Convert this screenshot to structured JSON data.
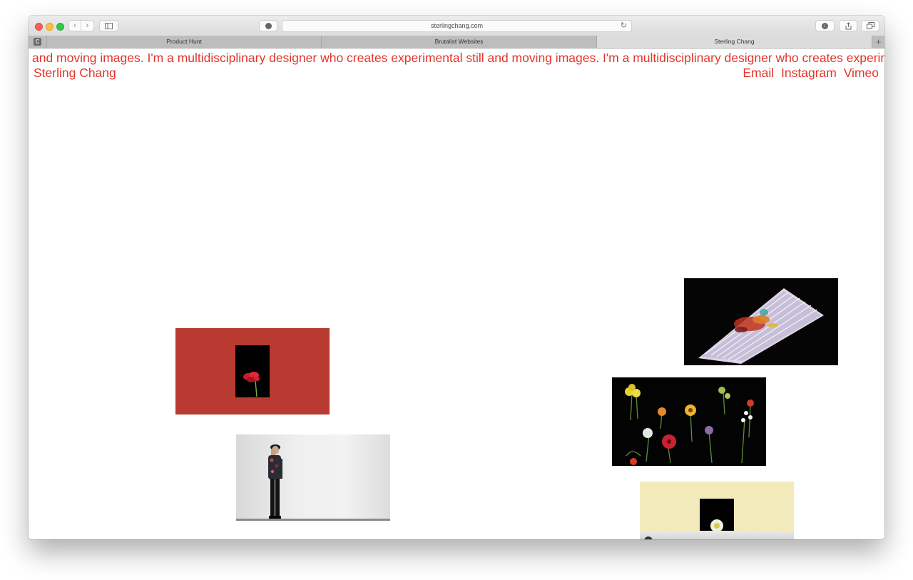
{
  "browser": {
    "url": "sterlingchang.com",
    "pinned_tab_label": "C",
    "tabs": [
      {
        "label": "Product Hunt"
      },
      {
        "label": "Brutalist Websites"
      },
      {
        "label": "Sterling Chang"
      }
    ],
    "active_tab_index": 2,
    "new_tab_label": "+"
  },
  "page": {
    "marquee_text": "and moving images. I'm a multidisciplinary designer who creates experimental still and moving images. I'm a multidisciplinary designer who creates experimental still and moving images. I'm a multidisciplinary designer who creates experimen",
    "site_name": "Sterling Chang",
    "links": [
      {
        "label": "Email"
      },
      {
        "label": "Instagram"
      },
      {
        "label": "Vimeo"
      }
    ],
    "accent_color": "#e5342a"
  }
}
